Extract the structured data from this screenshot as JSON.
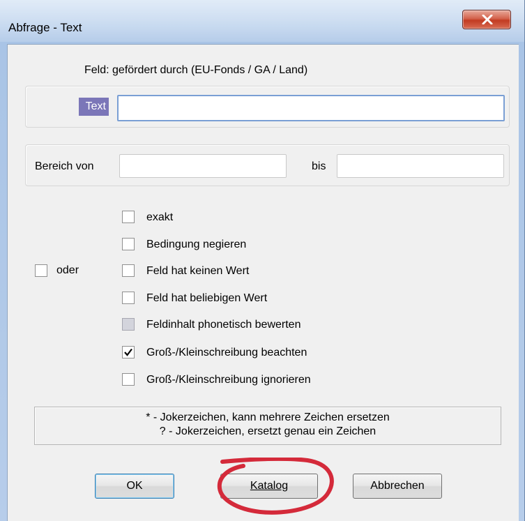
{
  "window": {
    "title": "Abfrage - Text",
    "close_symbol": "X"
  },
  "field_label": "Feld: gefördert durch (EU-Fonds / GA / Land)",
  "text_input": {
    "label": "Text",
    "value": ""
  },
  "range": {
    "from_label": "Bereich von",
    "from_value": "",
    "to_label": "bis",
    "to_value": ""
  },
  "oder": {
    "label": "oder",
    "checked": false
  },
  "options": [
    {
      "label": "exakt",
      "checked": false,
      "disabled": false
    },
    {
      "label": "Bedingung negieren",
      "checked": false,
      "disabled": false
    },
    {
      "label": "Feld hat keinen Wert",
      "checked": false,
      "disabled": false
    },
    {
      "label": "Feld hat beliebigen Wert",
      "checked": false,
      "disabled": false
    },
    {
      "label": "Feldinhalt phonetisch bewerten",
      "checked": false,
      "disabled": true
    },
    {
      "label": "Groß-/Kleinschreibung beachten",
      "checked": true,
      "disabled": false
    },
    {
      "label": "Groß-/Kleinschreibung ignorieren",
      "checked": false,
      "disabled": false
    }
  ],
  "hints": [
    "* - Jokerzeichen, kann mehrere Zeichen ersetzen",
    "? - Jokerzeichen, ersetzt genau ein Zeichen"
  ],
  "buttons": {
    "ok": "OK",
    "catalog": "Katalog",
    "cancel": "Abbrechen"
  },
  "colors": {
    "annotation_circle": "#d42a3a",
    "text_tag": "#7b76b8"
  }
}
